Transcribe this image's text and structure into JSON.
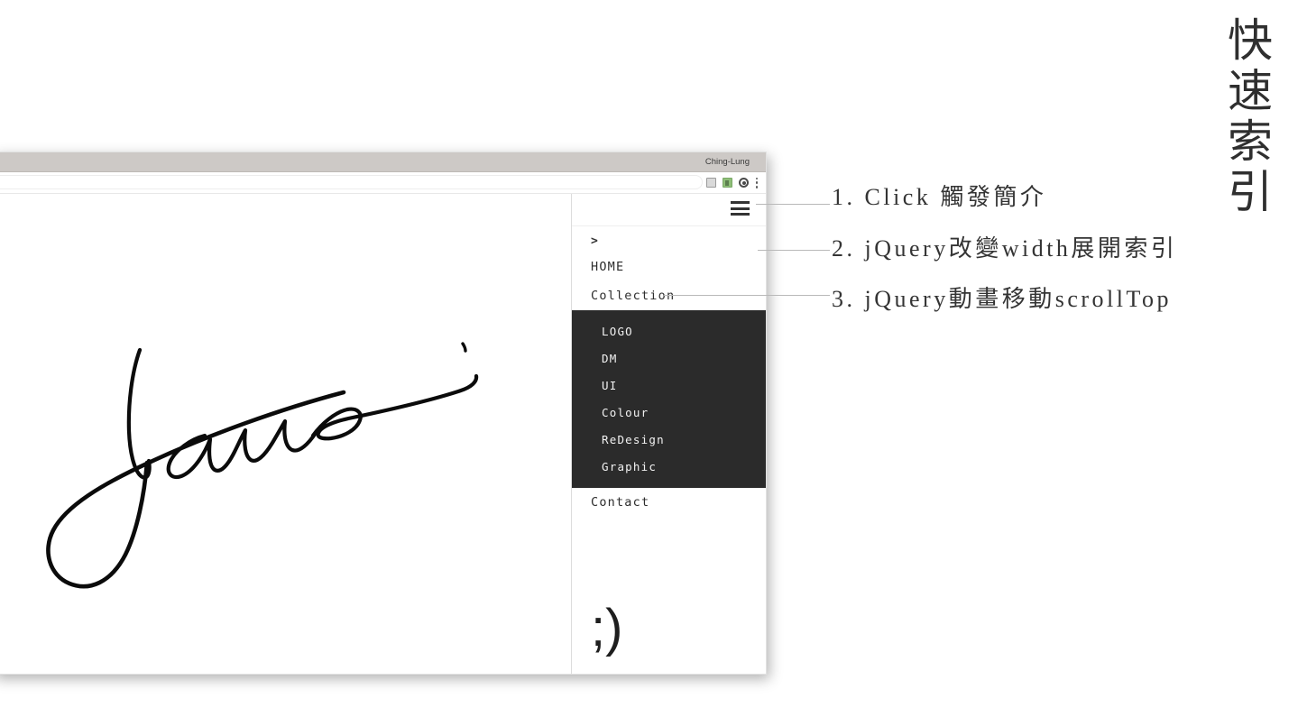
{
  "vertical_title": "快速索引",
  "browser": {
    "tab_title": "Ching-Lung",
    "toolbar_icons": [
      "cast-icon",
      "extension-icon",
      "profile-avatar-icon",
      "kebab-menu-icon"
    ]
  },
  "site": {
    "signature_alt": "James",
    "hamburger_label": "menu-toggle",
    "chevron_label": ">",
    "nav_items": [
      {
        "label": "HOME"
      },
      {
        "label": "Collection"
      }
    ],
    "submenu_items": [
      {
        "label": "LOGO"
      },
      {
        "label": "DM"
      },
      {
        "label": "UI"
      },
      {
        "label": "Colour"
      },
      {
        "label": "ReDesign"
      },
      {
        "label": "Graphic"
      }
    ],
    "contact_item": {
      "label": "Contact"
    },
    "emoticon": ";)"
  },
  "annotations": [
    {
      "text": "1. Click 觸發簡介"
    },
    {
      "text": "2. jQuery改變width展開索引"
    },
    {
      "text": "3. jQuery動畫移動scrollTop"
    }
  ],
  "colors": {
    "page_background": "#ffffff",
    "tab_strip": "#cdc9c6",
    "submenu_background": "#2b2b2b",
    "text_dark": "#2d2d2d",
    "annotation_text": "#343434",
    "leader_line": "#b9b9b9"
  }
}
